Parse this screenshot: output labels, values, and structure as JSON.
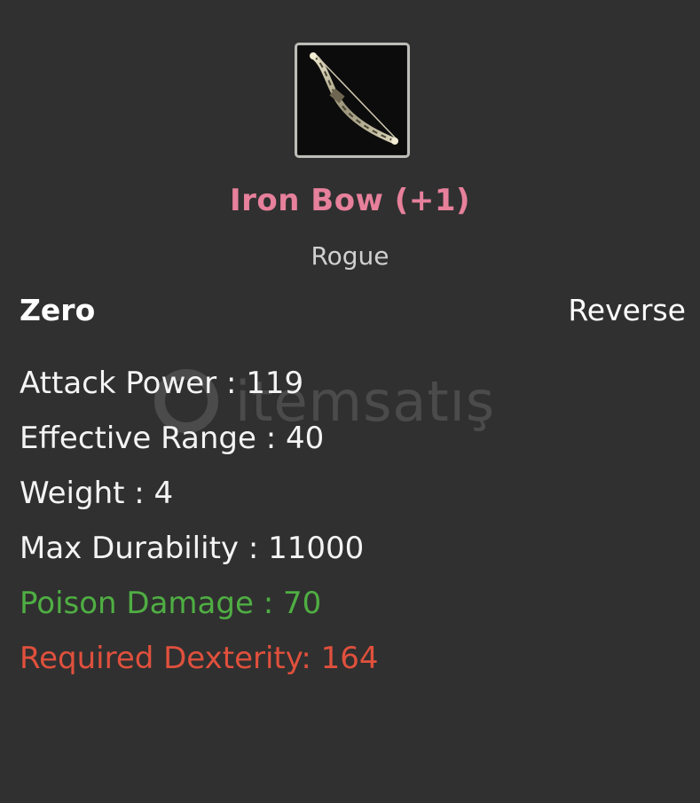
{
  "item": {
    "icon": "bow-icon",
    "name": "Iron Bow (+1)",
    "class": "Rogue",
    "tag_left": "Zero",
    "tag_right": "Reverse"
  },
  "stats": [
    {
      "text": "Attack Power : 119",
      "color": "#f4f4f4"
    },
    {
      "text": "Effective Range : 40",
      "color": "#f4f4f4"
    },
    {
      "text": "Weight : 4",
      "color": "#f4f4f4"
    },
    {
      "text": "Max Durability : 11000",
      "color": "#f4f4f4"
    },
    {
      "text": "Poison Damage : 70",
      "color": "#4fae43"
    },
    {
      "text": "Required Dexterity: 164",
      "color": "#e0503d"
    }
  ],
  "watermark": {
    "text": "itemsatış",
    "logo": "itemsatis-logo-icon"
  },
  "colors": {
    "background": "#303030",
    "item_name": "#e6809b",
    "class": "#d0d0d0"
  }
}
